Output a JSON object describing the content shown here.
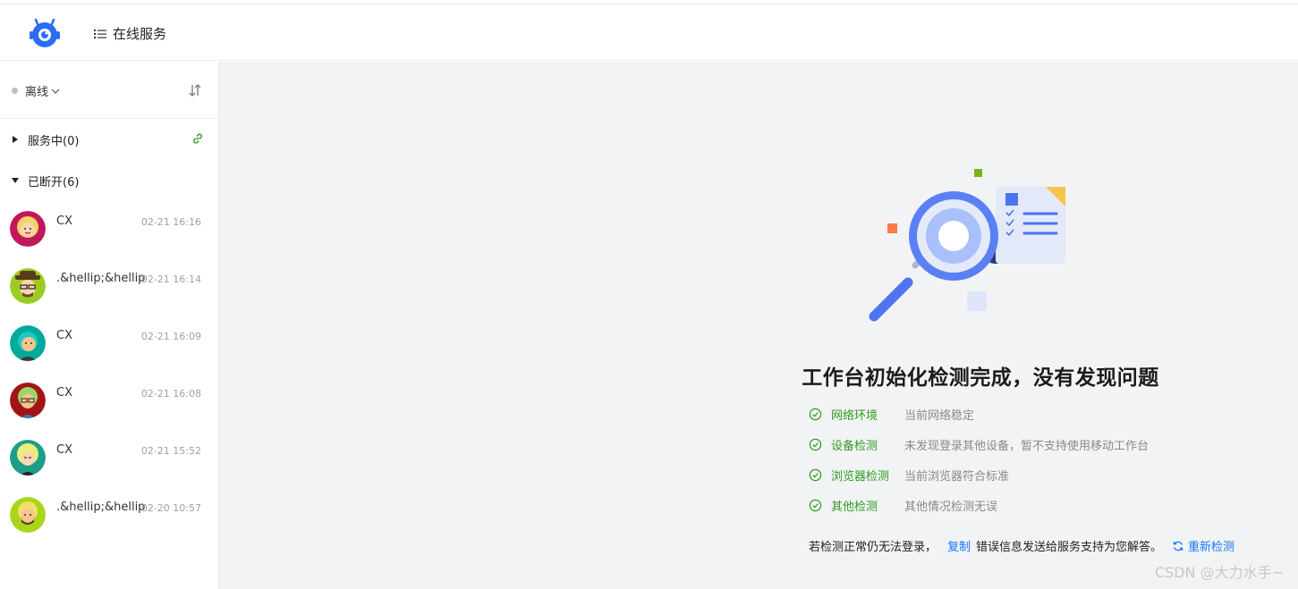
{
  "header": {
    "logo_icon": "robot-logo-icon",
    "menu_icon": "list-icon",
    "menu_label": "在线服务"
  },
  "sidebar": {
    "status": {
      "label": "离线",
      "dot_color": "#bfbfbf",
      "icon": "chevron-down-icon"
    },
    "sort_icon": "sort-icon",
    "groups": [
      {
        "label": "服务中(0)",
        "expanded": false,
        "icon": "link-icon",
        "icon_color": "#2f9a1f"
      },
      {
        "label": "已断开(6)",
        "expanded": true
      }
    ],
    "sessions": [
      {
        "name": "CX",
        "time": "02-21 16:16",
        "avatar_bg": "#c2185b"
      },
      {
        "name": ".&hellip;&hellip;",
        "time": "02-21 16:14",
        "avatar_bg": "#9ccc21"
      },
      {
        "name": "CX",
        "time": "02-21 16:09",
        "avatar_bg": "#00a99d"
      },
      {
        "name": "CX",
        "time": "02-21 16:08",
        "avatar_bg": "#a31515"
      },
      {
        "name": "CX",
        "time": "02-21 15:52",
        "avatar_bg": "#1b9e8a"
      },
      {
        "name": ".&hellip;&hellip;",
        "time": "02-20 10:57",
        "avatar_bg": "#a8d61c"
      }
    ]
  },
  "main": {
    "illustration": "magnifier-document-icon",
    "title": "工作台初始化检测完成，没有发现问题",
    "checks": [
      {
        "name": "网络环境",
        "desc": "当前网络稳定"
      },
      {
        "name": "设备检测",
        "desc": "未发现登录其他设备，暂不支持使用移动工作台"
      },
      {
        "name": "浏览器检测",
        "desc": "当前浏览器符合标准"
      },
      {
        "name": "其他检测",
        "desc": "其他情况检测无误"
      }
    ],
    "check_color": "#2f9a1f",
    "footer": {
      "prefix": "若检测正常仍无法登录，",
      "copy": "复制",
      "suffix": "错误信息发送给服务支持为您解答。",
      "recheck": "重新检测",
      "recheck_icon": "refresh-icon"
    },
    "watermark": "CSDN @大力水手~"
  }
}
